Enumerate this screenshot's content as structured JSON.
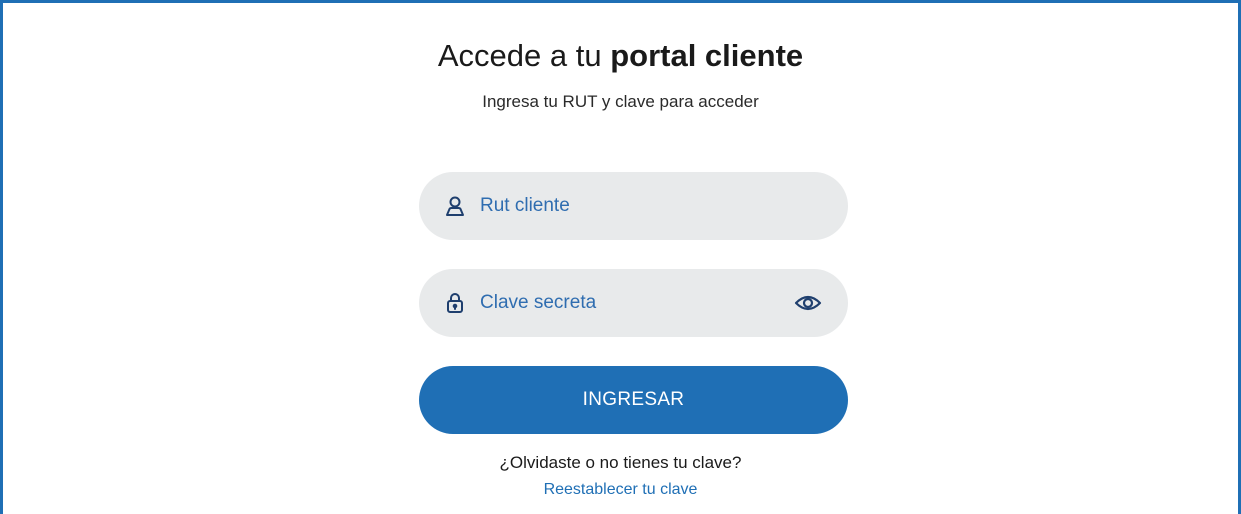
{
  "header": {
    "title_prefix": "Accede a tu ",
    "title_bold": "portal cliente",
    "subtitle": "Ingresa tu RUT y clave para acceder"
  },
  "form": {
    "rut_field": {
      "placeholder": "Rut cliente",
      "value": "",
      "icon": "user-icon"
    },
    "password_field": {
      "placeholder": "Clave secreta",
      "value": "",
      "icon": "lock-icon",
      "toggle_icon": "eye-icon"
    },
    "submit_label": "INGRESAR"
  },
  "help": {
    "forgot_text": "¿Olvidaste o no tienes tu clave?",
    "reset_link": "Reestablecer tu clave"
  },
  "colors": {
    "accent": "#1f6fb5",
    "field_background": "#e8eaeb",
    "placeholder_text": "#2f6db0",
    "frame_border": "#1f6fb5"
  }
}
